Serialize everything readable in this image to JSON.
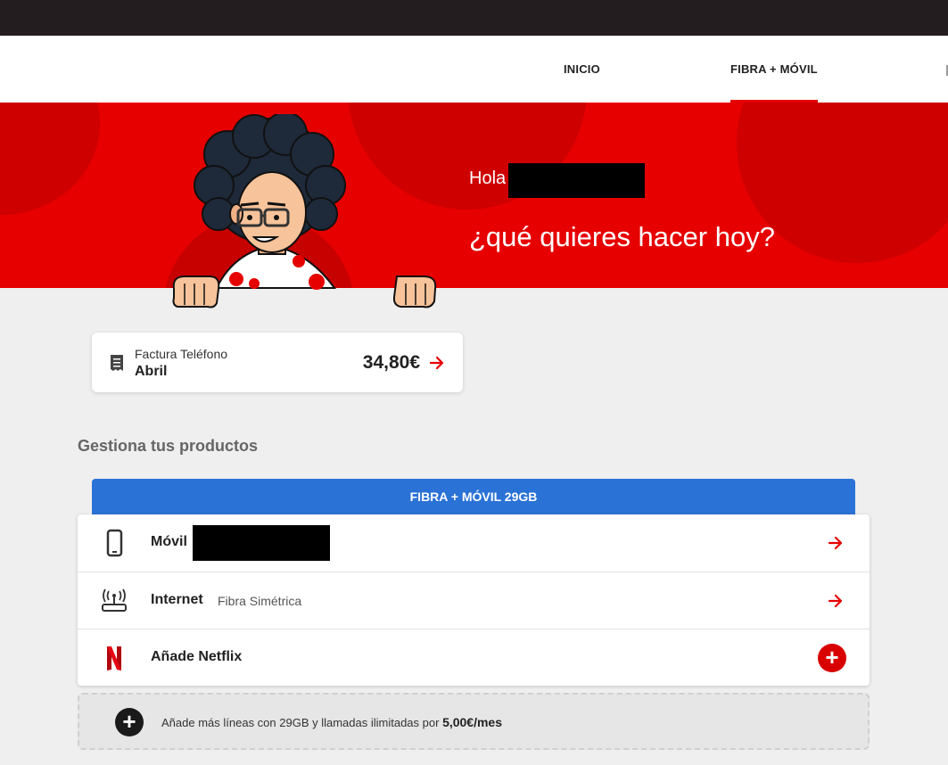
{
  "nav": {
    "items": [
      {
        "label": "INICIO",
        "active": false
      },
      {
        "label": "FIBRA + MÓVIL",
        "active": true
      }
    ]
  },
  "hero": {
    "greeting": "Hola",
    "question": "¿qué quieres hacer hoy?"
  },
  "bill": {
    "title": "Factura Teléfono",
    "month": "Abril",
    "amount": "34,80€",
    "icon": "receipt-icon"
  },
  "products": {
    "section_title": "Gestiona tus productos",
    "tab_label": "FIBRA + MÓVIL 29GB",
    "rows": [
      {
        "label": "Móvil",
        "sub": "",
        "icon": "mobile-phone-icon",
        "action": "arrow"
      },
      {
        "label": "Internet",
        "sub": "Fibra Simétrica",
        "icon": "router-icon",
        "action": "arrow"
      },
      {
        "label": "Añade Netflix",
        "sub": "",
        "icon": "netflix-icon",
        "action": "add"
      }
    ]
  },
  "more_lines": {
    "text": "Añade más líneas con 29GB y llamadas ilimitadas por",
    "price": "5,00€/mes"
  },
  "colors": {
    "brand_red": "#e60000",
    "tab_blue": "#2a72d6",
    "topbar": "#231d1f"
  }
}
